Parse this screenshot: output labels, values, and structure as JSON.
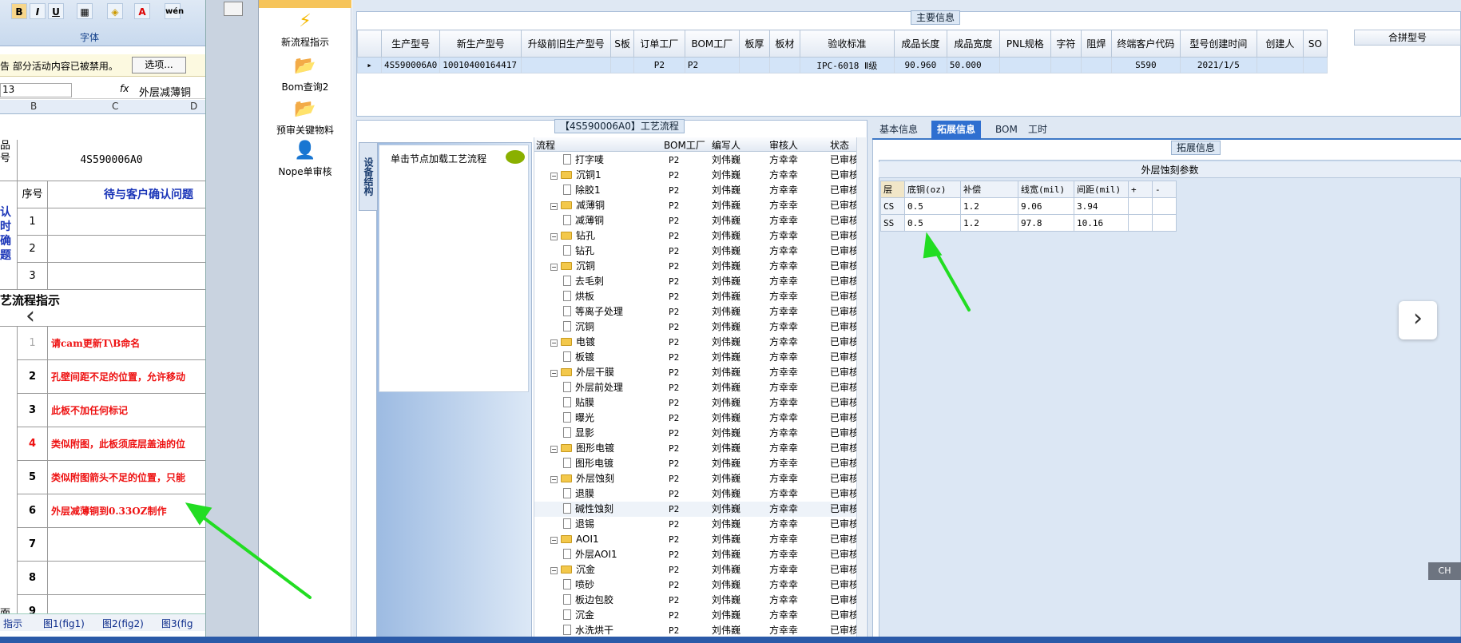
{
  "excel": {
    "font_group_label": "字体",
    "message": "告  部分活动内容已被禁用。",
    "options_button": "选项...",
    "name_box": "13",
    "fx": "fx",
    "formula_value": "外层减薄铜",
    "columns": [
      "B",
      "C",
      "D"
    ],
    "product_label": "品号",
    "product_value": "4S590006A0",
    "seq_label": "序号",
    "confirm_header": "待与客户确认问题",
    "confirm_side": "认时确题",
    "process_header": "艺流程指示",
    "row_numbers": [
      "1",
      "2",
      "3",
      "1",
      "2",
      "3",
      "4",
      "5",
      "6",
      "7",
      "8",
      "9"
    ],
    "instructions": [
      "请cam更新T\\B命名",
      "孔壁间距不足的位置，允许移动",
      "此板不加任何标记",
      "类似附图，此板须底层盖油的位",
      "类似附图箭头不足的位置，只能",
      "外层减薄铜到0.33OZ制作"
    ],
    "side_label": "面示",
    "sheet_tabs": [
      "指示",
      "图1(fig1)",
      "图2(fig2)",
      "图3(fig"
    ]
  },
  "toolbox": {
    "items": [
      "新流程指示",
      "Bom查询2",
      "预审关键物料",
      "Nope单审核"
    ]
  },
  "main_info": {
    "group_title": "主要信息",
    "columns": [
      "生产型号",
      "新生产型号",
      "升级前旧生产型号",
      "S板",
      "订单工厂",
      "BOM工厂",
      "板厚",
      "板材",
      "验收标准",
      "成品长度",
      "成品宽度",
      "PNL规格",
      "字符",
      "阻焊",
      "终端客户代码",
      "型号创建时间",
      "创建人",
      "SO"
    ],
    "row": [
      "4S590006A0",
      "10010400164417",
      "",
      "",
      "P2",
      "P2",
      "",
      "",
      "IPC-6018 Ⅱ级",
      "90.960",
      "50.000",
      "",
      "",
      "",
      "S590",
      "2021/1/5",
      "",
      ""
    ],
    "merge_header": "合拼型号"
  },
  "process": {
    "group_title": "【4S590006A0】工艺流程",
    "vertical_tab": "设备结构",
    "load_hint": "单击节点加载工艺流程",
    "tree_headers": [
      "流程",
      "BOM工厂",
      "编写人",
      "审核人",
      "状态"
    ],
    "rows": [
      {
        "name": "打字唛",
        "type": "leaf",
        "factory": "P2",
        "writer": "刘伟巍",
        "reviewer": "方幸幸",
        "status": "已审核"
      },
      {
        "name": "沉铜1",
        "type": "folder",
        "factory": "P2",
        "writer": "刘伟巍",
        "reviewer": "方幸幸",
        "status": "已审核"
      },
      {
        "name": "除胶1",
        "type": "leaf",
        "factory": "P2",
        "writer": "刘伟巍",
        "reviewer": "方幸幸",
        "status": "已审核"
      },
      {
        "name": "减薄铜",
        "type": "folder",
        "factory": "P2",
        "writer": "刘伟巍",
        "reviewer": "方幸幸",
        "status": "已审核"
      },
      {
        "name": "减薄铜",
        "type": "leaf",
        "factory": "P2",
        "writer": "刘伟巍",
        "reviewer": "方幸幸",
        "status": "已审核"
      },
      {
        "name": "钻孔",
        "type": "folder",
        "factory": "P2",
        "writer": "刘伟巍",
        "reviewer": "方幸幸",
        "status": "已审核"
      },
      {
        "name": "钻孔",
        "type": "leaf",
        "factory": "P2",
        "writer": "刘伟巍",
        "reviewer": "方幸幸",
        "status": "已审核"
      },
      {
        "name": "沉铜",
        "type": "folder",
        "factory": "P2",
        "writer": "刘伟巍",
        "reviewer": "方幸幸",
        "status": "已审核"
      },
      {
        "name": "去毛刺",
        "type": "leaf",
        "factory": "P2",
        "writer": "刘伟巍",
        "reviewer": "方幸幸",
        "status": "已审核"
      },
      {
        "name": "烘板",
        "type": "leaf",
        "factory": "P2",
        "writer": "刘伟巍",
        "reviewer": "方幸幸",
        "status": "已审核"
      },
      {
        "name": "等离子处理",
        "type": "leaf",
        "factory": "P2",
        "writer": "刘伟巍",
        "reviewer": "方幸幸",
        "status": "已审核"
      },
      {
        "name": "沉铜",
        "type": "leaf",
        "factory": "P2",
        "writer": "刘伟巍",
        "reviewer": "方幸幸",
        "status": "已审核"
      },
      {
        "name": "电镀",
        "type": "folder",
        "factory": "P2",
        "writer": "刘伟巍",
        "reviewer": "方幸幸",
        "status": "已审核"
      },
      {
        "name": "板镀",
        "type": "leaf",
        "factory": "P2",
        "writer": "刘伟巍",
        "reviewer": "方幸幸",
        "status": "已审核"
      },
      {
        "name": "外层干膜",
        "type": "folder",
        "factory": "P2",
        "writer": "刘伟巍",
        "reviewer": "方幸幸",
        "status": "已审核"
      },
      {
        "name": "外层前处理",
        "type": "leaf",
        "factory": "P2",
        "writer": "刘伟巍",
        "reviewer": "方幸幸",
        "status": "已审核"
      },
      {
        "name": "贴膜",
        "type": "leaf",
        "factory": "P2",
        "writer": "刘伟巍",
        "reviewer": "方幸幸",
        "status": "已审核"
      },
      {
        "name": "曝光",
        "type": "leaf",
        "factory": "P2",
        "writer": "刘伟巍",
        "reviewer": "方幸幸",
        "status": "已审核"
      },
      {
        "name": "显影",
        "type": "leaf",
        "factory": "P2",
        "writer": "刘伟巍",
        "reviewer": "方幸幸",
        "status": "已审核"
      },
      {
        "name": "图形电镀",
        "type": "folder",
        "factory": "P2",
        "writer": "刘伟巍",
        "reviewer": "方幸幸",
        "status": "已审核"
      },
      {
        "name": "图形电镀",
        "type": "leaf",
        "factory": "P2",
        "writer": "刘伟巍",
        "reviewer": "方幸幸",
        "status": "已审核"
      },
      {
        "name": "外层蚀刻",
        "type": "folder",
        "factory": "P2",
        "writer": "刘伟巍",
        "reviewer": "方幸幸",
        "status": "已审核"
      },
      {
        "name": "退膜",
        "type": "leaf",
        "factory": "P2",
        "writer": "刘伟巍",
        "reviewer": "方幸幸",
        "status": "已审核"
      },
      {
        "name": "碱性蚀刻",
        "type": "leaf",
        "factory": "P2",
        "writer": "刘伟巍",
        "reviewer": "方幸幸",
        "status": "已审核",
        "highlight": true
      },
      {
        "name": "退锡",
        "type": "leaf",
        "factory": "P2",
        "writer": "刘伟巍",
        "reviewer": "方幸幸",
        "status": "已审核"
      },
      {
        "name": "AOI1",
        "type": "folder",
        "factory": "P2",
        "writer": "刘伟巍",
        "reviewer": "方幸幸",
        "status": "已审核"
      },
      {
        "name": "外层AOI1",
        "type": "leaf",
        "factory": "P2",
        "writer": "刘伟巍",
        "reviewer": "方幸幸",
        "status": "已审核"
      },
      {
        "name": "沉金",
        "type": "folder",
        "factory": "P2",
        "writer": "刘伟巍",
        "reviewer": "方幸幸",
        "status": "已审核"
      },
      {
        "name": "喷砂",
        "type": "leaf",
        "factory": "P2",
        "writer": "刘伟巍",
        "reviewer": "方幸幸",
        "status": "已审核"
      },
      {
        "name": "板边包胶",
        "type": "leaf",
        "factory": "P2",
        "writer": "刘伟巍",
        "reviewer": "方幸幸",
        "status": "已审核"
      },
      {
        "name": "沉金",
        "type": "leaf",
        "factory": "P2",
        "writer": "刘伟巍",
        "reviewer": "方幸幸",
        "status": "已审核"
      },
      {
        "name": "水洗烘干",
        "type": "leaf",
        "factory": "P2",
        "writer": "刘伟巍",
        "reviewer": "方幸幸",
        "status": "已审核"
      }
    ]
  },
  "right_panel": {
    "tabs": [
      "基本信息",
      "拓展信息",
      "BOM",
      "工时"
    ],
    "active_tab": "拓展信息",
    "group_title": "拓展信息",
    "table_title": "外层蚀刻参数",
    "headers": [
      "层",
      "底铜(oz)",
      "补偿",
      "线宽(mil)",
      "间距(mil)",
      "+",
      "-"
    ],
    "rows": [
      [
        "CS",
        "0.5",
        "1.2",
        "9.06",
        "3.94",
        "",
        ""
      ],
      [
        "SS",
        "0.5",
        "1.2",
        "97.8",
        "10.16",
        "",
        ""
      ]
    ]
  },
  "ime_indicator": "CH",
  "colors": {
    "accent": "#2f6fd0",
    "annotation_arrow": "#22dd22",
    "warning_text": "#ee1111"
  }
}
